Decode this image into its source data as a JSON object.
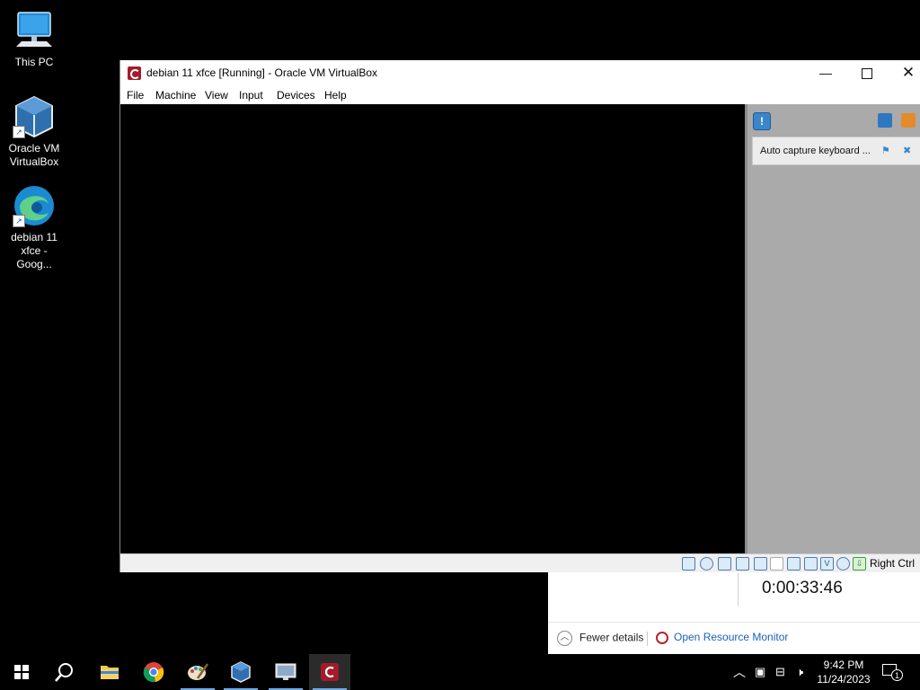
{
  "desktop": {
    "icons": [
      {
        "label": "This PC",
        "icon": "this-pc-icon"
      },
      {
        "label": "Oracle VM VirtualBox",
        "icon": "virtualbox-icon"
      },
      {
        "label": "debian 11 xfce - Goog...",
        "icon": "edge-icon"
      }
    ]
  },
  "vbox": {
    "title": "debian 11 xfce [Running] - Oracle VM VirtualBox",
    "menu": [
      "File",
      "Machine",
      "View",
      "Input",
      "Devices",
      "Help"
    ],
    "notice": "Auto capture keyboard ...",
    "host_key": "Right Ctrl",
    "colors": {
      "accent": "#3a86c9",
      "app_icon": "#a31b2b"
    }
  },
  "taskmgr": {
    "uptime": "0:00:33:46",
    "fewer_details": "Fewer details",
    "open_resource_monitor": "Open Resource Monitor"
  },
  "taskbar": {
    "apps": [
      "start-icon",
      "search-icon",
      "file-explorer-icon",
      "chrome-icon",
      "paint-icon",
      "virtualbox-icon",
      "remote-desktop-icon",
      "debian-vm-icon"
    ],
    "time": "9:42 PM",
    "date": "11/24/2023",
    "notification_count": "1"
  }
}
